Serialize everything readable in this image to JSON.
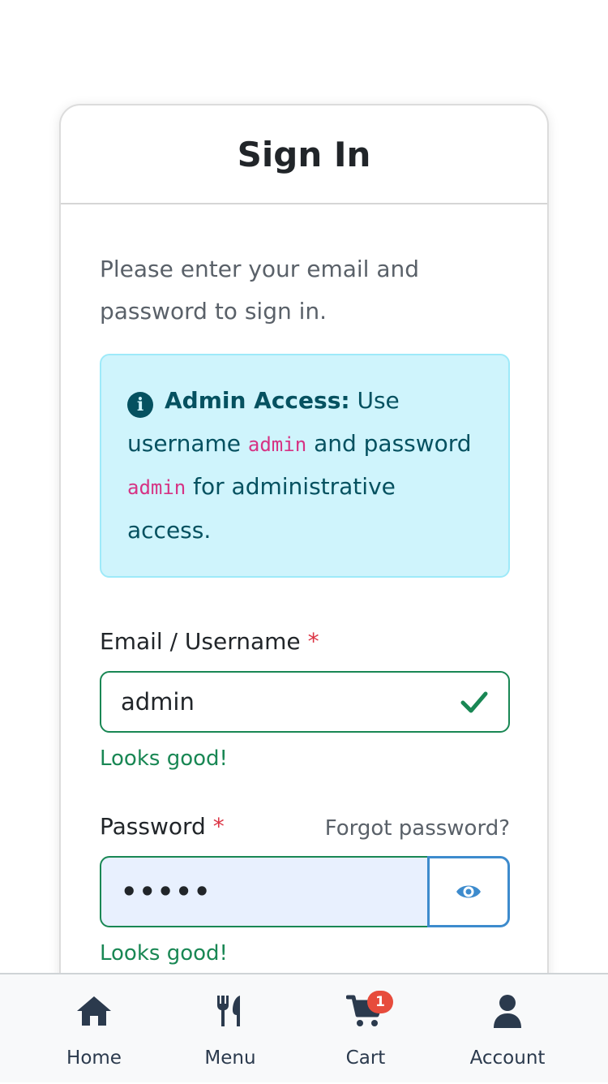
{
  "header": {
    "title": "Sign In"
  },
  "intro_text": "Please enter your email and password to sign in.",
  "alert": {
    "icon": "info-circle-icon",
    "title": "Admin Access:",
    "text_1": "Use username",
    "code_username": "admin",
    "text_2": "and password",
    "code_password": "admin",
    "text_3": "for administrative access."
  },
  "form": {
    "email_label": "Email / Username",
    "required_mark": "*",
    "email_value": "admin",
    "email_feedback": "Looks good!",
    "password_label": "Password",
    "forgot_link": "Forgot password?",
    "password_value": "•••••",
    "password_feedback": "Looks good!"
  },
  "colors": {
    "valid": "#198754",
    "alert_bg": "#cff4fc",
    "alert_text": "#055160",
    "code": "#d63384",
    "required": "#dc3545",
    "badge": "#e74c3c"
  },
  "bottom_nav": {
    "items": [
      {
        "label": "Home",
        "icon": "home-icon"
      },
      {
        "label": "Menu",
        "icon": "utensils-icon"
      },
      {
        "label": "Cart",
        "icon": "cart-icon",
        "badge": "1"
      },
      {
        "label": "Account",
        "icon": "user-icon"
      }
    ]
  }
}
